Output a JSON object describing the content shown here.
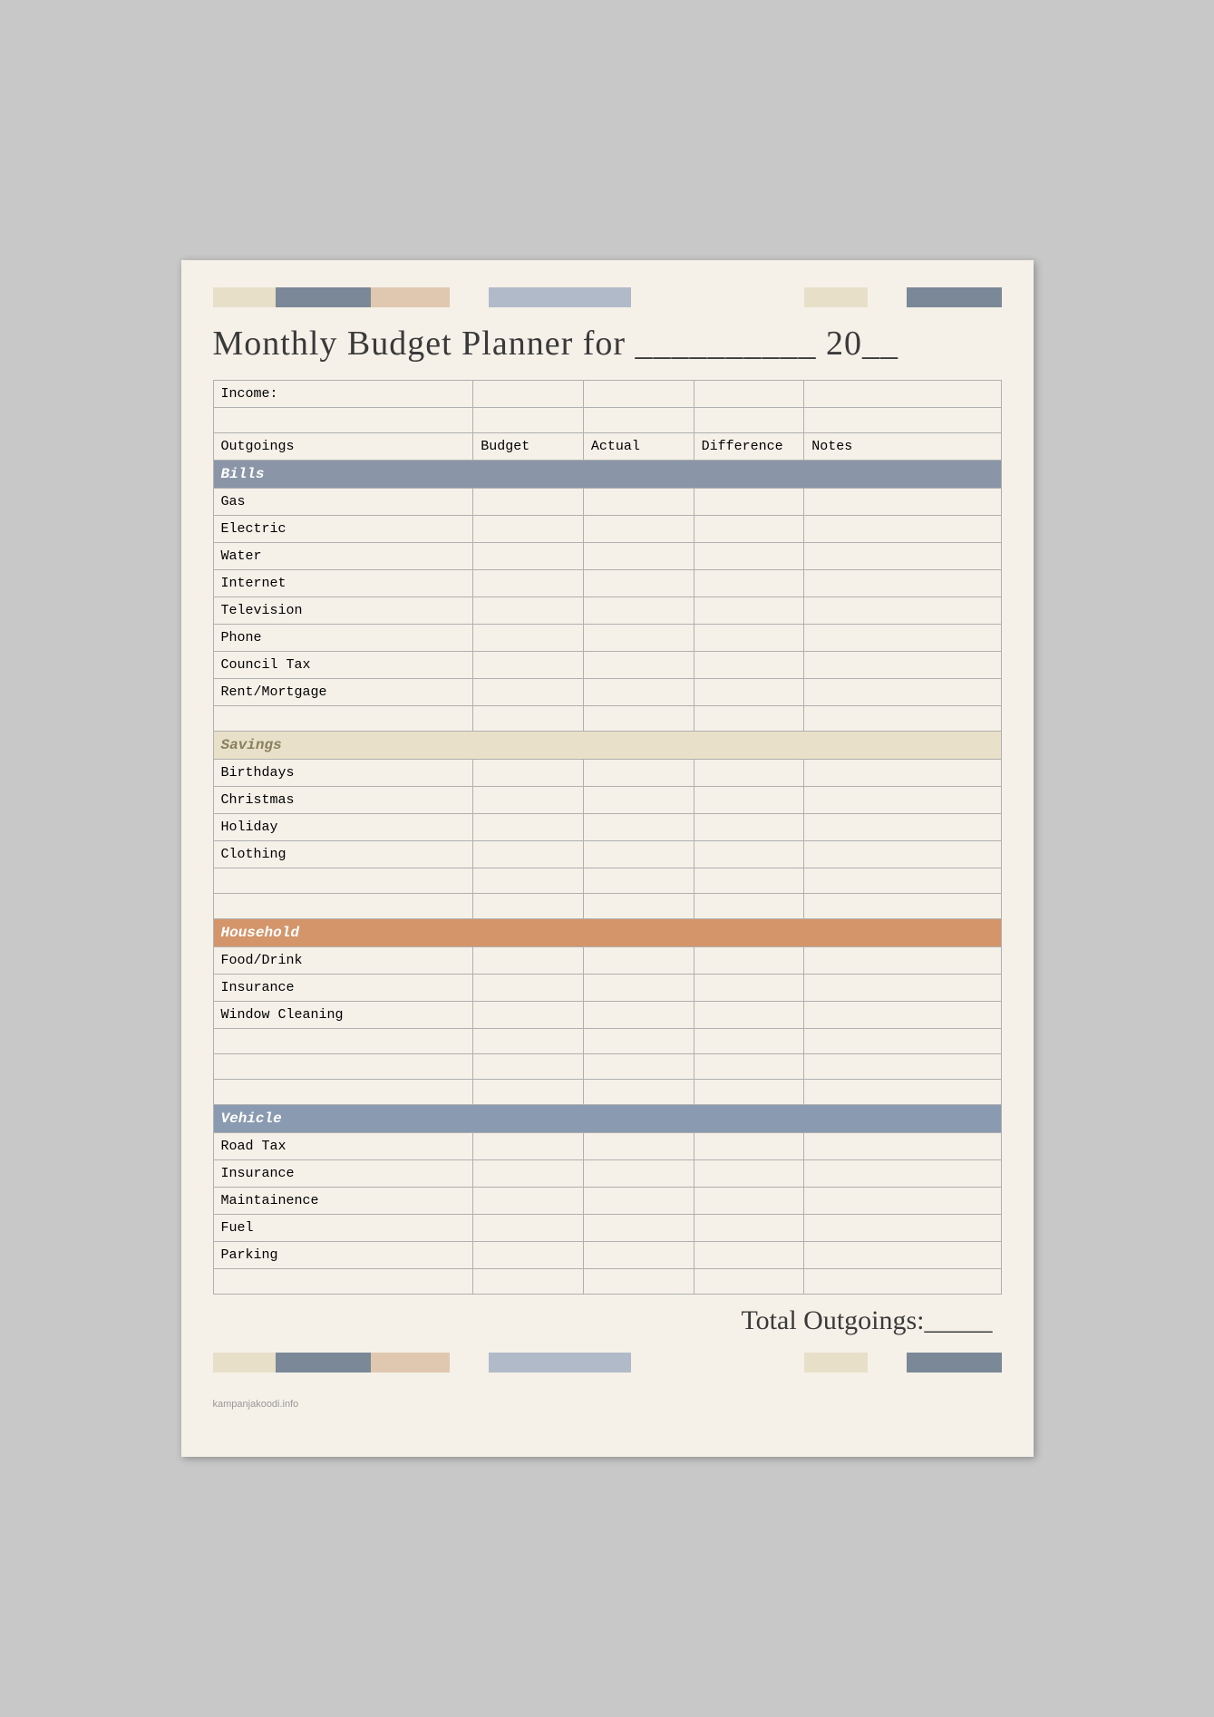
{
  "page": {
    "title": "Monthly Budget Planner for __________ 20__",
    "total_label": "Total Outgoings:_____",
    "watermark": "kampanjakoodi.info"
  },
  "top_strip": [
    {
      "color": "#e8dfc8",
      "width": "8%"
    },
    {
      "color": "#7a8898",
      "width": "12%"
    },
    {
      "color": "#e0c8b0",
      "width": "10%"
    },
    {
      "color": "#f5f0e8",
      "width": "5%"
    },
    {
      "color": "#b0bac8",
      "width": "18%"
    },
    {
      "color": "#f5f0e8",
      "width": "22%"
    },
    {
      "color": "#e8dfc8",
      "width": "8%"
    },
    {
      "color": "#f5f0e8",
      "width": "5%"
    },
    {
      "color": "#7a8898",
      "width": "12%"
    }
  ],
  "bottom_strip": [
    {
      "color": "#e8dfc8",
      "width": "8%"
    },
    {
      "color": "#7a8898",
      "width": "12%"
    },
    {
      "color": "#e0c8b0",
      "width": "10%"
    },
    {
      "color": "#f5f0e8",
      "width": "5%"
    },
    {
      "color": "#b0bac8",
      "width": "18%"
    },
    {
      "color": "#f5f0e8",
      "width": "22%"
    },
    {
      "color": "#e8dfc8",
      "width": "8%"
    },
    {
      "color": "#f5f0e8",
      "width": "5%"
    },
    {
      "color": "#7a8898",
      "width": "12%"
    }
  ],
  "headers": {
    "income": "Income:",
    "outgoings": "Outgoings",
    "budget": "Budget",
    "actual": "Actual",
    "difference": "Difference",
    "notes": "Notes"
  },
  "sections": {
    "bills": {
      "label": "Bills",
      "items": [
        "Gas",
        "Electric",
        "Water",
        "Internet",
        "Television",
        "Phone",
        "Council Tax",
        "Rent/Mortgage"
      ]
    },
    "savings": {
      "label": "Savings",
      "items": [
        "Birthdays",
        "Christmas",
        "Holiday",
        "Clothing"
      ]
    },
    "household": {
      "label": "Household",
      "items": [
        "Food/Drink",
        "Insurance",
        "Window Cleaning"
      ]
    },
    "vehicle": {
      "label": "Vehicle",
      "items": [
        "Road Tax",
        "Insurance",
        "Maintainence",
        "Fuel",
        "Parking"
      ]
    }
  }
}
